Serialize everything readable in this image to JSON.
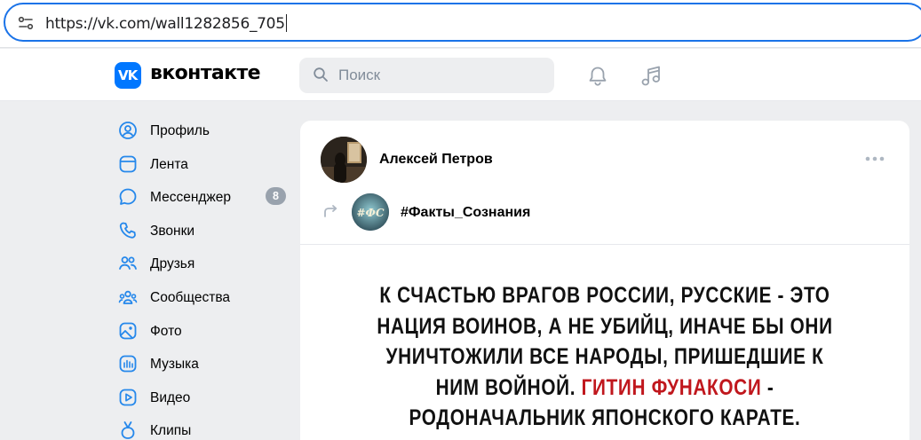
{
  "browser": {
    "url": "https://vk.com/wall1282856_705"
  },
  "header": {
    "logo_text": "VK",
    "brand": "вконтакте",
    "search_placeholder": "Поиск",
    "accent_color": "#0077ff"
  },
  "sidebar": {
    "items": [
      {
        "label": "Профиль",
        "icon": "profile-icon"
      },
      {
        "label": "Лента",
        "icon": "feed-icon"
      },
      {
        "label": "Мессенджер",
        "icon": "messenger-icon",
        "badge": "8"
      },
      {
        "label": "Звонки",
        "icon": "phone-icon"
      },
      {
        "label": "Друзья",
        "icon": "friends-icon"
      },
      {
        "label": "Сообщества",
        "icon": "communities-icon"
      },
      {
        "label": "Фото",
        "icon": "photo-icon"
      },
      {
        "label": "Музыка",
        "icon": "music-icon"
      },
      {
        "label": "Видео",
        "icon": "video-icon"
      },
      {
        "label": "Клипы",
        "icon": "clips-icon"
      }
    ]
  },
  "post": {
    "author": "Алексей Петров",
    "source": "#Факты_Сознания",
    "source_avatar_text": "#ФС",
    "quote_part1": "К СЧАСТЬЮ ВРАГОВ РОССИИ, РУССКИЕ - ЭТО НАЦИЯ ВОИНОВ, А НЕ УБИЙЦ, ИНАЧЕ БЫ ОНИ УНИЧТОЖИЛИ ВСЕ НАРОДЫ, ПРИШЕДШИЕ К НИМ ВОЙНОЙ.",
    "quote_author": "ГИТИН ФУНАКОСИ",
    "quote_part2": "- РОДОНАЧАЛЬНИК ЯПОНСКОГО КАРАТЕ.",
    "highlight_color": "#c0171d"
  }
}
